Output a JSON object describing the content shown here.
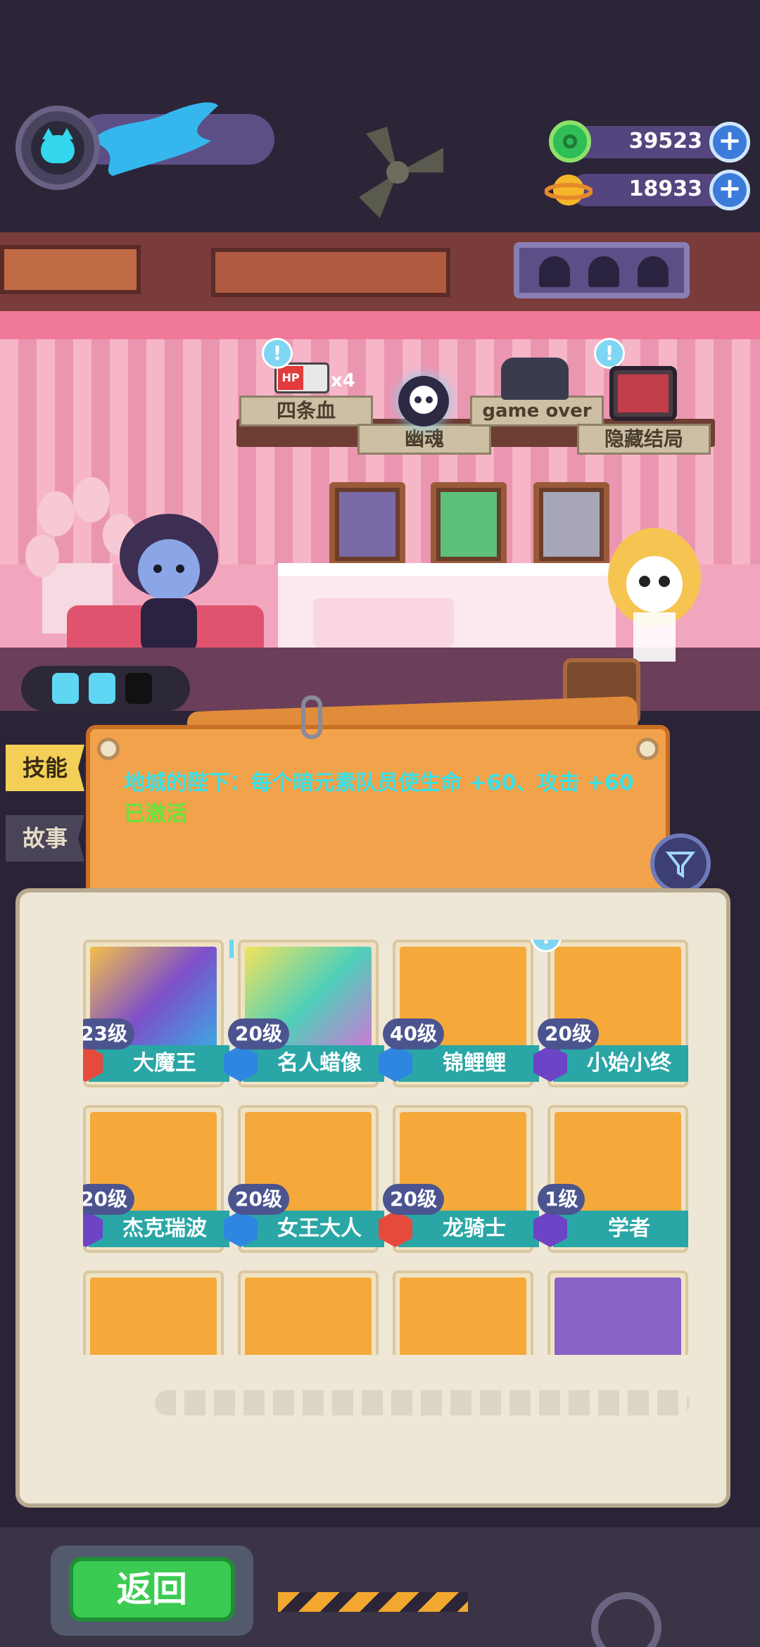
{
  "currency": [
    {
      "name": "gems",
      "icon": "green-gem-icon",
      "value": "39523",
      "add_label": "+"
    },
    {
      "name": "gold",
      "icon": "planet-coin-icon",
      "value": "18933",
      "add_label": "+"
    }
  ],
  "room": {
    "shelf_tags": [
      "四条血",
      "幽魂",
      "game over",
      "隐藏结局"
    ],
    "hp_badge": "HP",
    "hp_multiplier": "x4",
    "alert_mark": "!"
  },
  "side_tabs": [
    "技能",
    "故事"
  ],
  "skill": {
    "text": "地城的陛下：每个暗元素队员使生命 +60、攻击 +60 ",
    "status": "已激活"
  },
  "roster": [
    {
      "level": "23级",
      "name": "大魔王",
      "element": "fire",
      "selected": true
    },
    {
      "level": "20级",
      "name": "名人蜡像",
      "element": "water"
    },
    {
      "level": "40级",
      "name": "锦鲤鲤",
      "element": "water"
    },
    {
      "level": "20级",
      "name": "小始小终",
      "element": "dark",
      "alert": "!"
    },
    {
      "level": "20级",
      "name": "杰克瑞波",
      "element": "dark"
    },
    {
      "level": "20级",
      "name": "女王大人",
      "element": "water"
    },
    {
      "level": "20级",
      "name": "龙骑士",
      "element": "fire"
    },
    {
      "level": "1级",
      "name": "学者",
      "element": "dark"
    }
  ],
  "back_label": "返回",
  "colors": {
    "accent_cyan": "#3be0e6",
    "active_green": "#69e23b",
    "card_bar": "#2aa6a6"
  }
}
